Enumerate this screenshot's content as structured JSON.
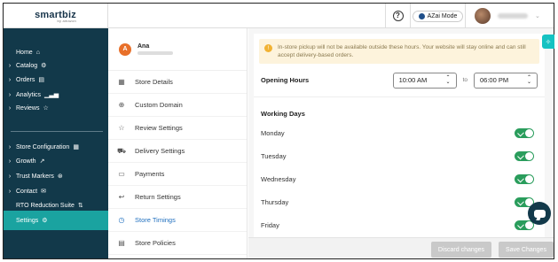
{
  "brand": {
    "logo": "smartbiz",
    "logo_sub": "by amazon"
  },
  "header": {
    "help_symbol": "?",
    "azai_label": "AZai Mode",
    "user_chevron": "⌄"
  },
  "sidebar": {
    "items": [
      {
        "arrow": "",
        "label": "Home",
        "icon": "⌂",
        "icon_name": "home-icon"
      },
      {
        "arrow": "›",
        "label": "Catalog",
        "icon": "⚙",
        "icon_name": "catalog-icon"
      },
      {
        "arrow": "›",
        "label": "Orders",
        "icon": "▤",
        "icon_name": "orders-icon"
      },
      {
        "arrow": "›",
        "label": "Analytics",
        "icon": "▁▃▅",
        "icon_name": "analytics-icon"
      },
      {
        "arrow": "›",
        "label": "Reviews",
        "icon": "☆",
        "icon_name": "star-icon"
      },
      {
        "arrow": "›",
        "label": "Store Configuration",
        "icon": "▦",
        "icon_name": "store-icon"
      },
      {
        "arrow": "›",
        "label": "Growth",
        "icon": "↗",
        "icon_name": "growth-icon"
      },
      {
        "arrow": "›",
        "label": "Trust Markers",
        "icon": "⊛",
        "icon_name": "trust-icon"
      },
      {
        "arrow": "›",
        "label": "Contact",
        "icon": "✉",
        "icon_name": "contact-icon"
      },
      {
        "arrow": "",
        "label": "RTO Reduction Suite",
        "icon": "⇅",
        "icon_name": "rto-icon"
      },
      {
        "arrow": "",
        "label": "Settings",
        "icon": "⚙",
        "icon_name": "settings-icon",
        "active": true
      }
    ]
  },
  "profile": {
    "initial": "A",
    "name": "Ana"
  },
  "settings_menu": {
    "items": [
      {
        "label": "Store Details",
        "icon": "▦"
      },
      {
        "label": "Custom Domain",
        "icon": "⊕"
      },
      {
        "label": "Review Settings",
        "icon": "☆"
      },
      {
        "label": "Delivery Settings",
        "icon": "⛟"
      },
      {
        "label": "Payments",
        "icon": "▭"
      },
      {
        "label": "Return Settings",
        "icon": "↩"
      },
      {
        "label": "Store Timings",
        "icon": "◷",
        "active": true
      },
      {
        "label": "Store Policies",
        "icon": "▤"
      }
    ]
  },
  "main": {
    "notice": "In-store pickup will not be available outside these hours. Your website will stay online and can still accept delivery-based orders.",
    "opening_hours_label": "Opening Hours",
    "open_time": "10:00 AM",
    "close_time": "06:00 PM",
    "to_label": "to",
    "working_days_label": "Working Days",
    "days": [
      {
        "name": "Monday",
        "enabled": true
      },
      {
        "name": "Tuesday",
        "enabled": true
      },
      {
        "name": "Wednesday",
        "enabled": true
      },
      {
        "name": "Thursday",
        "enabled": true
      },
      {
        "name": "Friday",
        "enabled": true
      }
    ],
    "discard_label": "Discard changes",
    "save_label": "Save Changes"
  },
  "colors": {
    "sidebar_bg": "#12394a",
    "active_teal": "#1aa3a0",
    "toggle_on": "#2a9d5c",
    "link_blue": "#1f6fbf"
  }
}
